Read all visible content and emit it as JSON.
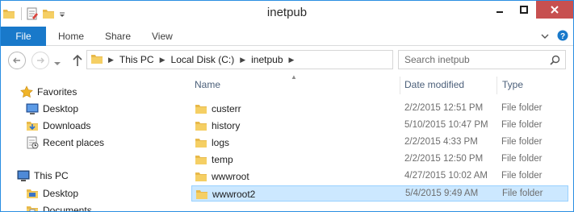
{
  "window": {
    "title": "inetpub"
  },
  "colors": {
    "accent": "#1979ca",
    "close": "#c75050",
    "selection": "#cce8ff",
    "header": "#4c607a"
  },
  "ribbon": {
    "tabs": [
      {
        "label": "File"
      },
      {
        "label": "Home"
      },
      {
        "label": "Share"
      },
      {
        "label": "View"
      }
    ]
  },
  "address": {
    "crumbs": [
      "This PC",
      "Local Disk (C:)",
      "inetpub"
    ]
  },
  "search": {
    "placeholder": "Search inetpub"
  },
  "navpane": {
    "favorites": {
      "label": "Favorites",
      "items": [
        {
          "label": "Desktop",
          "icon": "desktop-icon"
        },
        {
          "label": "Downloads",
          "icon": "downloads-icon"
        },
        {
          "label": "Recent places",
          "icon": "recent-places-icon"
        }
      ]
    },
    "thispc": {
      "label": "This PC",
      "items": [
        {
          "label": "Desktop",
          "icon": "desktop-icon"
        },
        {
          "label": "Documents",
          "icon": "documents-icon"
        }
      ]
    }
  },
  "list": {
    "columns": {
      "name": "Name",
      "date": "Date modified",
      "type": "Type"
    },
    "rows": [
      {
        "name": "custerr",
        "date": "2/2/2015 12:51 PM",
        "type": "File folder",
        "selected": false
      },
      {
        "name": "history",
        "date": "5/10/2015 10:47 PM",
        "type": "File folder",
        "selected": false
      },
      {
        "name": "logs",
        "date": "2/2/2015 4:33 PM",
        "type": "File folder",
        "selected": false
      },
      {
        "name": "temp",
        "date": "2/2/2015 12:50 PM",
        "type": "File folder",
        "selected": false
      },
      {
        "name": "wwwroot",
        "date": "4/27/2015 10:02 AM",
        "type": "File folder",
        "selected": false
      },
      {
        "name": "wwwroot2",
        "date": "5/4/2015 9:49 AM",
        "type": "File folder",
        "selected": true
      }
    ]
  }
}
